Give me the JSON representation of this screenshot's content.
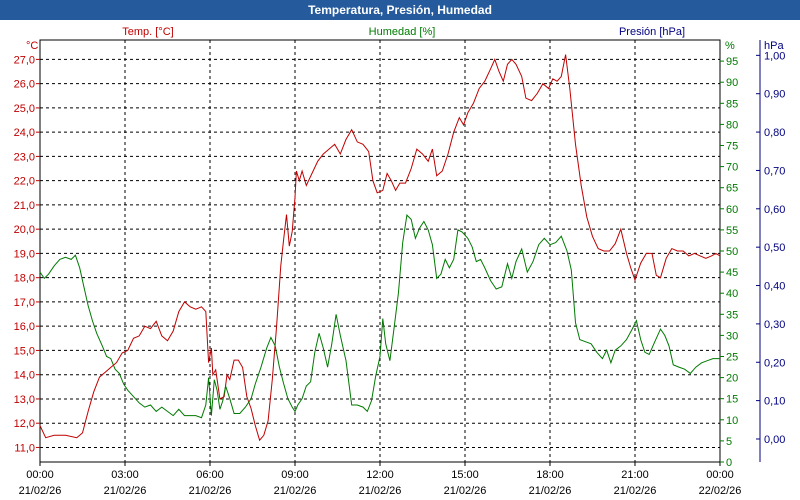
{
  "title": "Temperatura, Presión, Humedad",
  "colors": {
    "title_bg": "#255b9c",
    "temperature": "#c00000",
    "humidity": "#007a00",
    "pressure": "#000080",
    "grid": "#000000"
  },
  "chart_data": {
    "type": "line",
    "title": "Temperatura, Presión, Humedad",
    "grid": true,
    "x_range": [
      "21/02/26 00:00",
      "22/02/26 00:00"
    ],
    "x_ticks": [
      {
        "time": "00:00",
        "date": "21/02/26"
      },
      {
        "time": "03:00",
        "date": "21/02/26"
      },
      {
        "time": "06:00",
        "date": "21/02/26"
      },
      {
        "time": "09:00",
        "date": "21/02/26"
      },
      {
        "time": "12:00",
        "date": "21/02/26"
      },
      {
        "time": "15:00",
        "date": "21/02/26"
      },
      {
        "time": "18:00",
        "date": "21/02/26"
      },
      {
        "time": "21:00",
        "date": "21/02/26"
      },
      {
        "time": "00:00",
        "date": "22/02/26"
      }
    ],
    "axes": {
      "temperature": {
        "unit": "°C",
        "range": [
          10.4,
          27.8
        ],
        "ticks": [
          "11,0",
          "12,0",
          "13,0",
          "14,0",
          "15,0",
          "16,0",
          "17,0",
          "18,0",
          "19,0",
          "20,0",
          "21,0",
          "22,0",
          "23,0",
          "24,0",
          "25,0",
          "26,0",
          "27,0"
        ]
      },
      "humidity": {
        "unit": "%",
        "range": [
          0,
          100
        ],
        "ticks": [
          "0",
          "5",
          "10",
          "15",
          "20",
          "25",
          "30",
          "35",
          "40",
          "45",
          "50",
          "55",
          "60",
          "65",
          "70",
          "75",
          "80",
          "85",
          "90",
          "95"
        ]
      },
      "pressure": {
        "unit": "hPa",
        "range": [
          -0.06,
          1.04
        ],
        "ticks": [
          "0,00",
          "0,10",
          "0,20",
          "0,30",
          "0,40",
          "0,50",
          "0,60",
          "0,70",
          "0,80",
          "0,90",
          "1,00"
        ]
      }
    },
    "legend": [
      {
        "name": "Temp. [°C]",
        "axis": "temperature"
      },
      {
        "name": "Humedad [%]",
        "axis": "humidity"
      },
      {
        "name": "Presión [hPa]",
        "axis": "pressure"
      }
    ],
    "series": [
      {
        "name": "Temp. [°C]",
        "axis": "temperature",
        "points": [
          [
            0.0,
            11.9
          ],
          [
            0.2,
            11.4
          ],
          [
            0.5,
            11.5
          ],
          [
            0.9,
            11.5
          ],
          [
            1.3,
            11.4
          ],
          [
            1.5,
            11.6
          ],
          [
            1.7,
            12.5
          ],
          [
            1.9,
            13.3
          ],
          [
            2.1,
            13.9
          ],
          [
            2.3,
            14.1
          ],
          [
            2.5,
            14.3
          ],
          [
            2.7,
            14.5
          ],
          [
            2.9,
            14.9
          ],
          [
            3.1,
            15.0
          ],
          [
            3.3,
            15.5
          ],
          [
            3.5,
            15.6
          ],
          [
            3.7,
            16.0
          ],
          [
            3.9,
            15.9
          ],
          [
            4.1,
            16.2
          ],
          [
            4.3,
            15.6
          ],
          [
            4.5,
            15.4
          ],
          [
            4.7,
            15.8
          ],
          [
            4.9,
            16.6
          ],
          [
            5.1,
            17.0
          ],
          [
            5.3,
            16.8
          ],
          [
            5.5,
            16.7
          ],
          [
            5.7,
            16.8
          ],
          [
            5.85,
            16.6
          ],
          [
            5.95,
            14.5
          ],
          [
            6.05,
            15.1
          ],
          [
            6.1,
            14.0
          ],
          [
            6.2,
            14.2
          ],
          [
            6.35,
            13.0
          ],
          [
            6.5,
            13.1
          ],
          [
            6.6,
            14.0
          ],
          [
            6.7,
            13.8
          ],
          [
            6.85,
            14.6
          ],
          [
            7.0,
            14.6
          ],
          [
            7.15,
            14.3
          ],
          [
            7.3,
            13.1
          ],
          [
            7.45,
            12.6
          ],
          [
            7.6,
            11.9
          ],
          [
            7.75,
            11.3
          ],
          [
            7.9,
            11.5
          ],
          [
            8.05,
            12.1
          ],
          [
            8.2,
            13.8
          ],
          [
            8.35,
            16.0
          ],
          [
            8.5,
            18.5
          ],
          [
            8.6,
            19.6
          ],
          [
            8.7,
            20.6
          ],
          [
            8.8,
            19.3
          ],
          [
            8.9,
            19.9
          ],
          [
            9.0,
            21.3
          ],
          [
            9.05,
            22.4
          ],
          [
            9.15,
            22.0
          ],
          [
            9.25,
            22.4
          ],
          [
            9.4,
            21.8
          ],
          [
            9.6,
            22.3
          ],
          [
            9.8,
            22.8
          ],
          [
            10.0,
            23.1
          ],
          [
            10.2,
            23.3
          ],
          [
            10.4,
            23.5
          ],
          [
            10.6,
            23.1
          ],
          [
            10.8,
            23.7
          ],
          [
            11.0,
            24.1
          ],
          [
            11.2,
            23.6
          ],
          [
            11.4,
            23.5
          ],
          [
            11.6,
            23.2
          ],
          [
            11.75,
            22.0
          ],
          [
            11.9,
            21.5
          ],
          [
            12.1,
            21.6
          ],
          [
            12.25,
            22.3
          ],
          [
            12.4,
            22.0
          ],
          [
            12.55,
            21.6
          ],
          [
            12.7,
            21.9
          ],
          [
            12.9,
            21.9
          ],
          [
            13.1,
            22.5
          ],
          [
            13.3,
            23.3
          ],
          [
            13.5,
            23.1
          ],
          [
            13.7,
            22.8
          ],
          [
            13.85,
            23.3
          ],
          [
            14.0,
            22.2
          ],
          [
            14.2,
            22.4
          ],
          [
            14.4,
            23.1
          ],
          [
            14.6,
            24.0
          ],
          [
            14.8,
            24.6
          ],
          [
            14.95,
            24.3
          ],
          [
            15.1,
            24.8
          ],
          [
            15.3,
            25.2
          ],
          [
            15.5,
            25.8
          ],
          [
            15.7,
            26.1
          ],
          [
            15.9,
            26.6
          ],
          [
            16.05,
            27.0
          ],
          [
            16.2,
            26.5
          ],
          [
            16.35,
            26.1
          ],
          [
            16.5,
            26.8
          ],
          [
            16.65,
            27.0
          ],
          [
            16.8,
            26.8
          ],
          [
            17.0,
            26.3
          ],
          [
            17.15,
            25.4
          ],
          [
            17.35,
            25.3
          ],
          [
            17.55,
            25.6
          ],
          [
            17.75,
            26.0
          ],
          [
            17.95,
            25.8
          ],
          [
            18.1,
            26.2
          ],
          [
            18.25,
            26.1
          ],
          [
            18.4,
            26.3
          ],
          [
            18.55,
            27.2
          ],
          [
            18.7,
            25.8
          ],
          [
            18.9,
            23.5
          ],
          [
            19.1,
            21.8
          ],
          [
            19.3,
            20.5
          ],
          [
            19.5,
            19.7
          ],
          [
            19.7,
            19.2
          ],
          [
            19.9,
            19.1
          ],
          [
            20.1,
            19.1
          ],
          [
            20.3,
            19.4
          ],
          [
            20.5,
            20.0
          ],
          [
            20.7,
            19.0
          ],
          [
            20.85,
            18.4
          ],
          [
            21.0,
            17.9
          ],
          [
            21.2,
            18.6
          ],
          [
            21.4,
            19.0
          ],
          [
            21.6,
            19.0
          ],
          [
            21.75,
            18.1
          ],
          [
            21.9,
            18.0
          ],
          [
            22.1,
            18.8
          ],
          [
            22.3,
            19.2
          ],
          [
            22.5,
            19.1
          ],
          [
            22.7,
            19.1
          ],
          [
            22.9,
            18.9
          ],
          [
            23.1,
            19.0
          ],
          [
            23.3,
            18.9
          ],
          [
            23.5,
            18.8
          ],
          [
            23.7,
            18.9
          ],
          [
            23.85,
            19.0
          ],
          [
            24.0,
            18.9
          ]
        ]
      },
      {
        "name": "Humedad [%]",
        "axis": "humidity",
        "points": [
          [
            0.0,
            45.0
          ],
          [
            0.15,
            43.5
          ],
          [
            0.3,
            44.5
          ],
          [
            0.5,
            46.5
          ],
          [
            0.7,
            48.0
          ],
          [
            0.9,
            48.5
          ],
          [
            1.1,
            48.0
          ],
          [
            1.25,
            49.0
          ],
          [
            1.4,
            46.0
          ],
          [
            1.55,
            41.5
          ],
          [
            1.7,
            37.0
          ],
          [
            1.85,
            33.5
          ],
          [
            2.0,
            30.5
          ],
          [
            2.2,
            27.5
          ],
          [
            2.35,
            25.0
          ],
          [
            2.5,
            24.5
          ],
          [
            2.65,
            22.0
          ],
          [
            2.8,
            21.0
          ],
          [
            2.95,
            18.5
          ],
          [
            3.1,
            17.0
          ],
          [
            3.3,
            15.5
          ],
          [
            3.5,
            14.0
          ],
          [
            3.7,
            13.0
          ],
          [
            3.9,
            13.5
          ],
          [
            4.1,
            12.0
          ],
          [
            4.3,
            13.0
          ],
          [
            4.5,
            12.0
          ],
          [
            4.7,
            11.0
          ],
          [
            4.9,
            12.5
          ],
          [
            5.1,
            11.0
          ],
          [
            5.3,
            11.0
          ],
          [
            5.5,
            11.0
          ],
          [
            5.7,
            10.5
          ],
          [
            5.85,
            13.5
          ],
          [
            5.95,
            20.0
          ],
          [
            6.05,
            11.0
          ],
          [
            6.15,
            19.5
          ],
          [
            6.25,
            17.0
          ],
          [
            6.35,
            12.5
          ],
          [
            6.45,
            14.5
          ],
          [
            6.55,
            18.0
          ],
          [
            6.7,
            15.0
          ],
          [
            6.85,
            11.5
          ],
          [
            7.05,
            11.5
          ],
          [
            7.25,
            13.0
          ],
          [
            7.45,
            15.0
          ],
          [
            7.6,
            18.5
          ],
          [
            7.8,
            22.5
          ],
          [
            8.0,
            27.0
          ],
          [
            8.15,
            29.5
          ],
          [
            8.3,
            27.5
          ],
          [
            8.45,
            22.5
          ],
          [
            8.6,
            18.5
          ],
          [
            8.75,
            15.0
          ],
          [
            8.9,
            13.0
          ],
          [
            9.0,
            12.0
          ],
          [
            9.1,
            13.5
          ],
          [
            9.25,
            15.0
          ],
          [
            9.4,
            18.0
          ],
          [
            9.55,
            19.0
          ],
          [
            9.7,
            26.0
          ],
          [
            9.85,
            30.5
          ],
          [
            10.0,
            27.0
          ],
          [
            10.15,
            22.5
          ],
          [
            10.3,
            28.0
          ],
          [
            10.45,
            35.0
          ],
          [
            10.6,
            30.0
          ],
          [
            10.8,
            24.0
          ],
          [
            11.0,
            13.5
          ],
          [
            11.2,
            13.5
          ],
          [
            11.4,
            13.0
          ],
          [
            11.55,
            12.0
          ],
          [
            11.7,
            14.5
          ],
          [
            11.85,
            20.5
          ],
          [
            12.0,
            25.0
          ],
          [
            12.1,
            34.0
          ],
          [
            12.2,
            28.0
          ],
          [
            12.35,
            24.0
          ],
          [
            12.5,
            32.0
          ],
          [
            12.65,
            40.0
          ],
          [
            12.8,
            52.0
          ],
          [
            12.95,
            58.5
          ],
          [
            13.1,
            57.5
          ],
          [
            13.25,
            53.0
          ],
          [
            13.4,
            55.5
          ],
          [
            13.55,
            57.0
          ],
          [
            13.7,
            55.0
          ],
          [
            13.85,
            51.5
          ],
          [
            14.0,
            43.5
          ],
          [
            14.15,
            44.5
          ],
          [
            14.3,
            48.0
          ],
          [
            14.45,
            46.0
          ],
          [
            14.6,
            48.0
          ],
          [
            14.75,
            55.0
          ],
          [
            14.9,
            54.5
          ],
          [
            15.1,
            53.0
          ],
          [
            15.25,
            51.0
          ],
          [
            15.4,
            47.5
          ],
          [
            15.55,
            48.0
          ],
          [
            15.7,
            46.0
          ],
          [
            15.9,
            43.0
          ],
          [
            16.1,
            41.0
          ],
          [
            16.3,
            41.5
          ],
          [
            16.5,
            47.0
          ],
          [
            16.65,
            43.5
          ],
          [
            16.8,
            47.5
          ],
          [
            17.0,
            50.5
          ],
          [
            17.2,
            45.0
          ],
          [
            17.4,
            47.5
          ],
          [
            17.6,
            51.5
          ],
          [
            17.8,
            53.0
          ],
          [
            18.0,
            51.5
          ],
          [
            18.2,
            52.0
          ],
          [
            18.4,
            53.5
          ],
          [
            18.6,
            50.0
          ],
          [
            18.75,
            45.5
          ],
          [
            18.9,
            33.0
          ],
          [
            19.05,
            29.0
          ],
          [
            19.25,
            28.5
          ],
          [
            19.45,
            28.0
          ],
          [
            19.65,
            26.0
          ],
          [
            19.85,
            24.5
          ],
          [
            20.0,
            26.5
          ],
          [
            20.15,
            23.5
          ],
          [
            20.3,
            26.5
          ],
          [
            20.5,
            27.5
          ],
          [
            20.7,
            29.0
          ],
          [
            20.9,
            31.5
          ],
          [
            21.05,
            33.5
          ],
          [
            21.2,
            29.0
          ],
          [
            21.35,
            26.0
          ],
          [
            21.5,
            25.5
          ],
          [
            21.7,
            28.5
          ],
          [
            21.9,
            31.5
          ],
          [
            22.05,
            30.0
          ],
          [
            22.2,
            27.5
          ],
          [
            22.35,
            23.0
          ],
          [
            22.55,
            22.5
          ],
          [
            22.75,
            22.0
          ],
          [
            22.95,
            21.0
          ],
          [
            23.15,
            22.5
          ],
          [
            23.35,
            23.5
          ],
          [
            23.55,
            24.0
          ],
          [
            23.75,
            24.5
          ],
          [
            24.0,
            24.5
          ]
        ]
      }
    ]
  }
}
